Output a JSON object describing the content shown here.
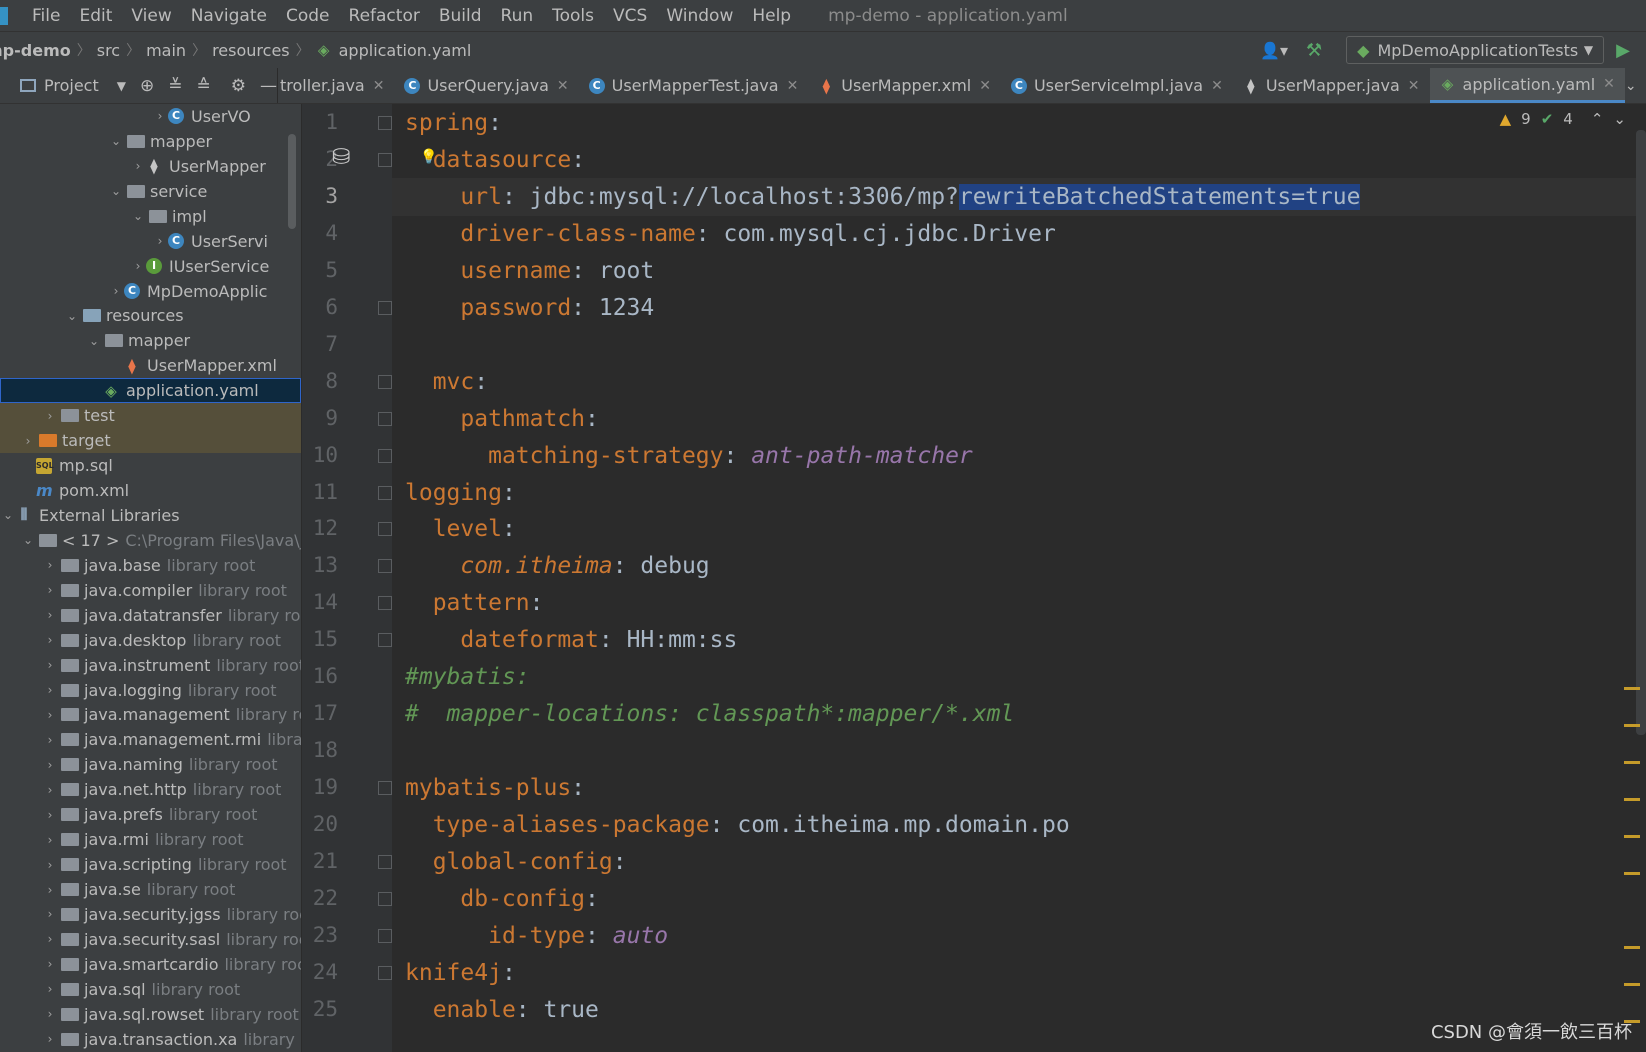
{
  "menu": {
    "items": [
      "File",
      "Edit",
      "View",
      "Navigate",
      "Code",
      "Refactor",
      "Build",
      "Run",
      "Tools",
      "VCS",
      "Window",
      "Help"
    ],
    "window_title": "mp-demo - application.yaml"
  },
  "breadcrumb": [
    "mp-demo",
    "src",
    "main",
    "resources",
    "application.yaml"
  ],
  "run_config": "MpDemoApplicationTests",
  "project_label": "Project",
  "tabs": [
    {
      "label": "troller.java",
      "icon": "java"
    },
    {
      "label": "UserQuery.java",
      "icon": "c"
    },
    {
      "label": "UserMapperTest.java",
      "icon": "c"
    },
    {
      "label": "UserMapper.xml",
      "icon": "xml"
    },
    {
      "label": "UserServiceImpl.java",
      "icon": "c"
    },
    {
      "label": "UserMapper.java",
      "icon": "java"
    },
    {
      "label": "application.yaml",
      "icon": "yaml",
      "active": true
    }
  ],
  "tree": [
    {
      "indent": 168,
      "arrow": "›",
      "icon": "c",
      "label": "UserVO"
    },
    {
      "indent": 124,
      "arrow": "⌄",
      "icon": "folder",
      "label": "mapper"
    },
    {
      "indent": 146,
      "arrow": "›",
      "icon": "java",
      "label": "UserMapper"
    },
    {
      "indent": 124,
      "arrow": "⌄",
      "icon": "folder",
      "label": "service"
    },
    {
      "indent": 146,
      "arrow": "⌄",
      "icon": "folder",
      "label": "impl"
    },
    {
      "indent": 168,
      "arrow": "›",
      "icon": "c",
      "label": "UserServi"
    },
    {
      "indent": 146,
      "arrow": "›",
      "icon": "i",
      "label": "IUserService"
    },
    {
      "indent": 124,
      "arrow": "›",
      "icon": "c",
      "label": "MpDemoApplic"
    },
    {
      "indent": 80,
      "arrow": "⌄",
      "icon": "folder-blue",
      "label": "resources"
    },
    {
      "indent": 102,
      "arrow": "⌄",
      "icon": "folder",
      "label": "mapper"
    },
    {
      "indent": 124,
      "arrow": "",
      "icon": "xml",
      "label": "UserMapper.xml"
    },
    {
      "indent": 102,
      "arrow": "",
      "icon": "yaml",
      "label": "application.yaml",
      "selected": true
    },
    {
      "indent": 58,
      "arrow": "›",
      "icon": "folder",
      "label": "test",
      "hl": true
    },
    {
      "indent": 36,
      "arrow": "›",
      "icon": "folder-orange",
      "label": "target",
      "hl": true
    },
    {
      "indent": 36,
      "arrow": "",
      "icon": "sql",
      "label": "mp.sql"
    },
    {
      "indent": 36,
      "arrow": "",
      "icon": "m",
      "label": "pom.xml"
    },
    {
      "indent": 14,
      "arrow": "⌄",
      "icon": "lib",
      "label": "External Libraries"
    },
    {
      "indent": 36,
      "arrow": "⌄",
      "icon": "folder",
      "label": "< 17 >",
      "gray": "C:\\Program Files\\Java\\j"
    },
    {
      "indent": 58,
      "arrow": "›",
      "icon": "folder",
      "label": "java.base",
      "gray": "library root"
    },
    {
      "indent": 58,
      "arrow": "›",
      "icon": "folder",
      "label": "java.compiler",
      "gray": "library root"
    },
    {
      "indent": 58,
      "arrow": "›",
      "icon": "folder",
      "label": "java.datatransfer",
      "gray": "library roo"
    },
    {
      "indent": 58,
      "arrow": "›",
      "icon": "folder",
      "label": "java.desktop",
      "gray": "library root"
    },
    {
      "indent": 58,
      "arrow": "›",
      "icon": "folder",
      "label": "java.instrument",
      "gray": "library root"
    },
    {
      "indent": 58,
      "arrow": "›",
      "icon": "folder",
      "label": "java.logging",
      "gray": "library root"
    },
    {
      "indent": 58,
      "arrow": "›",
      "icon": "folder",
      "label": "java.management",
      "gray": "library ro"
    },
    {
      "indent": 58,
      "arrow": "›",
      "icon": "folder",
      "label": "java.management.rmi",
      "gray": "librar"
    },
    {
      "indent": 58,
      "arrow": "›",
      "icon": "folder",
      "label": "java.naming",
      "gray": "library root"
    },
    {
      "indent": 58,
      "arrow": "›",
      "icon": "folder",
      "label": "java.net.http",
      "gray": "library root"
    },
    {
      "indent": 58,
      "arrow": "›",
      "icon": "folder",
      "label": "java.prefs",
      "gray": "library root"
    },
    {
      "indent": 58,
      "arrow": "›",
      "icon": "folder",
      "label": "java.rmi",
      "gray": "library root"
    },
    {
      "indent": 58,
      "arrow": "›",
      "icon": "folder",
      "label": "java.scripting",
      "gray": "library root"
    },
    {
      "indent": 58,
      "arrow": "›",
      "icon": "folder",
      "label": "java.se",
      "gray": "library root"
    },
    {
      "indent": 58,
      "arrow": "›",
      "icon": "folder",
      "label": "java.security.jgss",
      "gray": "library roo"
    },
    {
      "indent": 58,
      "arrow": "›",
      "icon": "folder",
      "label": "java.security.sasl",
      "gray": "library roo"
    },
    {
      "indent": 58,
      "arrow": "›",
      "icon": "folder",
      "label": "java.smartcardio",
      "gray": "library roo"
    },
    {
      "indent": 58,
      "arrow": "›",
      "icon": "folder",
      "label": "java.sql",
      "gray": "library root"
    },
    {
      "indent": 58,
      "arrow": "›",
      "icon": "folder",
      "label": "java.sql.rowset",
      "gray": "library root"
    },
    {
      "indent": 58,
      "arrow": "›",
      "icon": "folder",
      "label": "java.transaction.xa",
      "gray": "library ro"
    }
  ],
  "inspection": {
    "warnings": "9",
    "ok": "4"
  },
  "code": [
    {
      "n": "1",
      "tokens": [
        [
          "k",
          "spring"
        ],
        [
          "v",
          ":"
        ]
      ]
    },
    {
      "n": "2",
      "tokens": [
        [
          "v",
          "  "
        ],
        [
          "k",
          "datasource"
        ],
        [
          "v",
          ":"
        ]
      ]
    },
    {
      "n": "3",
      "current": true,
      "tokens": [
        [
          "v",
          "    "
        ],
        [
          "k",
          "url"
        ],
        [
          "v",
          ": jdbc:mysql://localhost:3306/mp?"
        ],
        [
          "s",
          "rewriteBatchedStatements=true"
        ]
      ]
    },
    {
      "n": "4",
      "tokens": [
        [
          "v",
          "    "
        ],
        [
          "k",
          "driver-class-name"
        ],
        [
          "v",
          ": com.mysql.cj.jdbc.Driver"
        ]
      ]
    },
    {
      "n": "5",
      "tokens": [
        [
          "v",
          "    "
        ],
        [
          "k",
          "username"
        ],
        [
          "v",
          ": root"
        ]
      ]
    },
    {
      "n": "6",
      "tokens": [
        [
          "v",
          "    "
        ],
        [
          "k",
          "password"
        ],
        [
          "v",
          ": 1234"
        ]
      ]
    },
    {
      "n": "7",
      "tokens": []
    },
    {
      "n": "8",
      "tokens": [
        [
          "v",
          "  "
        ],
        [
          "k",
          "mvc"
        ],
        [
          "v",
          ":"
        ]
      ]
    },
    {
      "n": "9",
      "tokens": [
        [
          "v",
          "    "
        ],
        [
          "k",
          "pathmatch"
        ],
        [
          "v",
          ":"
        ]
      ]
    },
    {
      "n": "10",
      "tokens": [
        [
          "v",
          "      "
        ],
        [
          "k",
          "matching-strategy"
        ],
        [
          "v",
          ": "
        ],
        [
          "p",
          "ant-path-matcher"
        ]
      ]
    },
    {
      "n": "11",
      "tokens": [
        [
          "k",
          "logging"
        ],
        [
          "v",
          ":"
        ]
      ]
    },
    {
      "n": "12",
      "tokens": [
        [
          "v",
          "  "
        ],
        [
          "k",
          "level"
        ],
        [
          "v",
          ":"
        ]
      ]
    },
    {
      "n": "13",
      "tokens": [
        [
          "v",
          "    "
        ],
        [
          "ki",
          "com.itheima"
        ],
        [
          "v",
          ": debug"
        ]
      ]
    },
    {
      "n": "14",
      "tokens": [
        [
          "v",
          "  "
        ],
        [
          "k",
          "pattern"
        ],
        [
          "v",
          ":"
        ]
      ]
    },
    {
      "n": "15",
      "tokens": [
        [
          "v",
          "    "
        ],
        [
          "k",
          "dateformat"
        ],
        [
          "v",
          ": HH:mm:ss"
        ]
      ]
    },
    {
      "n": "16",
      "tokens": [
        [
          "c",
          "#mybatis:"
        ]
      ]
    },
    {
      "n": "17",
      "tokens": [
        [
          "c",
          "#  mapper-locations: classpath*:mapper/*.xml"
        ]
      ]
    },
    {
      "n": "18",
      "tokens": []
    },
    {
      "n": "19",
      "tokens": [
        [
          "k",
          "mybatis-plus"
        ],
        [
          "v",
          ":"
        ]
      ]
    },
    {
      "n": "20",
      "tokens": [
        [
          "v",
          "  "
        ],
        [
          "k",
          "type-aliases-package"
        ],
        [
          "v",
          ": com.itheima.mp.domain.po"
        ]
      ]
    },
    {
      "n": "21",
      "tokens": [
        [
          "v",
          "  "
        ],
        [
          "k",
          "global-config"
        ],
        [
          "v",
          ":"
        ]
      ]
    },
    {
      "n": "22",
      "tokens": [
        [
          "v",
          "    "
        ],
        [
          "k",
          "db-config"
        ],
        [
          "v",
          ":"
        ]
      ]
    },
    {
      "n": "23",
      "tokens": [
        [
          "v",
          "      "
        ],
        [
          "k",
          "id-type"
        ],
        [
          "v",
          ": "
        ],
        [
          "p",
          "auto"
        ]
      ]
    },
    {
      "n": "24",
      "tokens": [
        [
          "k",
          "knife4j"
        ],
        [
          "v",
          ":"
        ]
      ]
    },
    {
      "n": "25",
      "tokens": [
        [
          "v",
          "  "
        ],
        [
          "k",
          "enable"
        ],
        [
          "v",
          ": true"
        ]
      ]
    }
  ],
  "watermark": "CSDN @會須一飲三百杯"
}
